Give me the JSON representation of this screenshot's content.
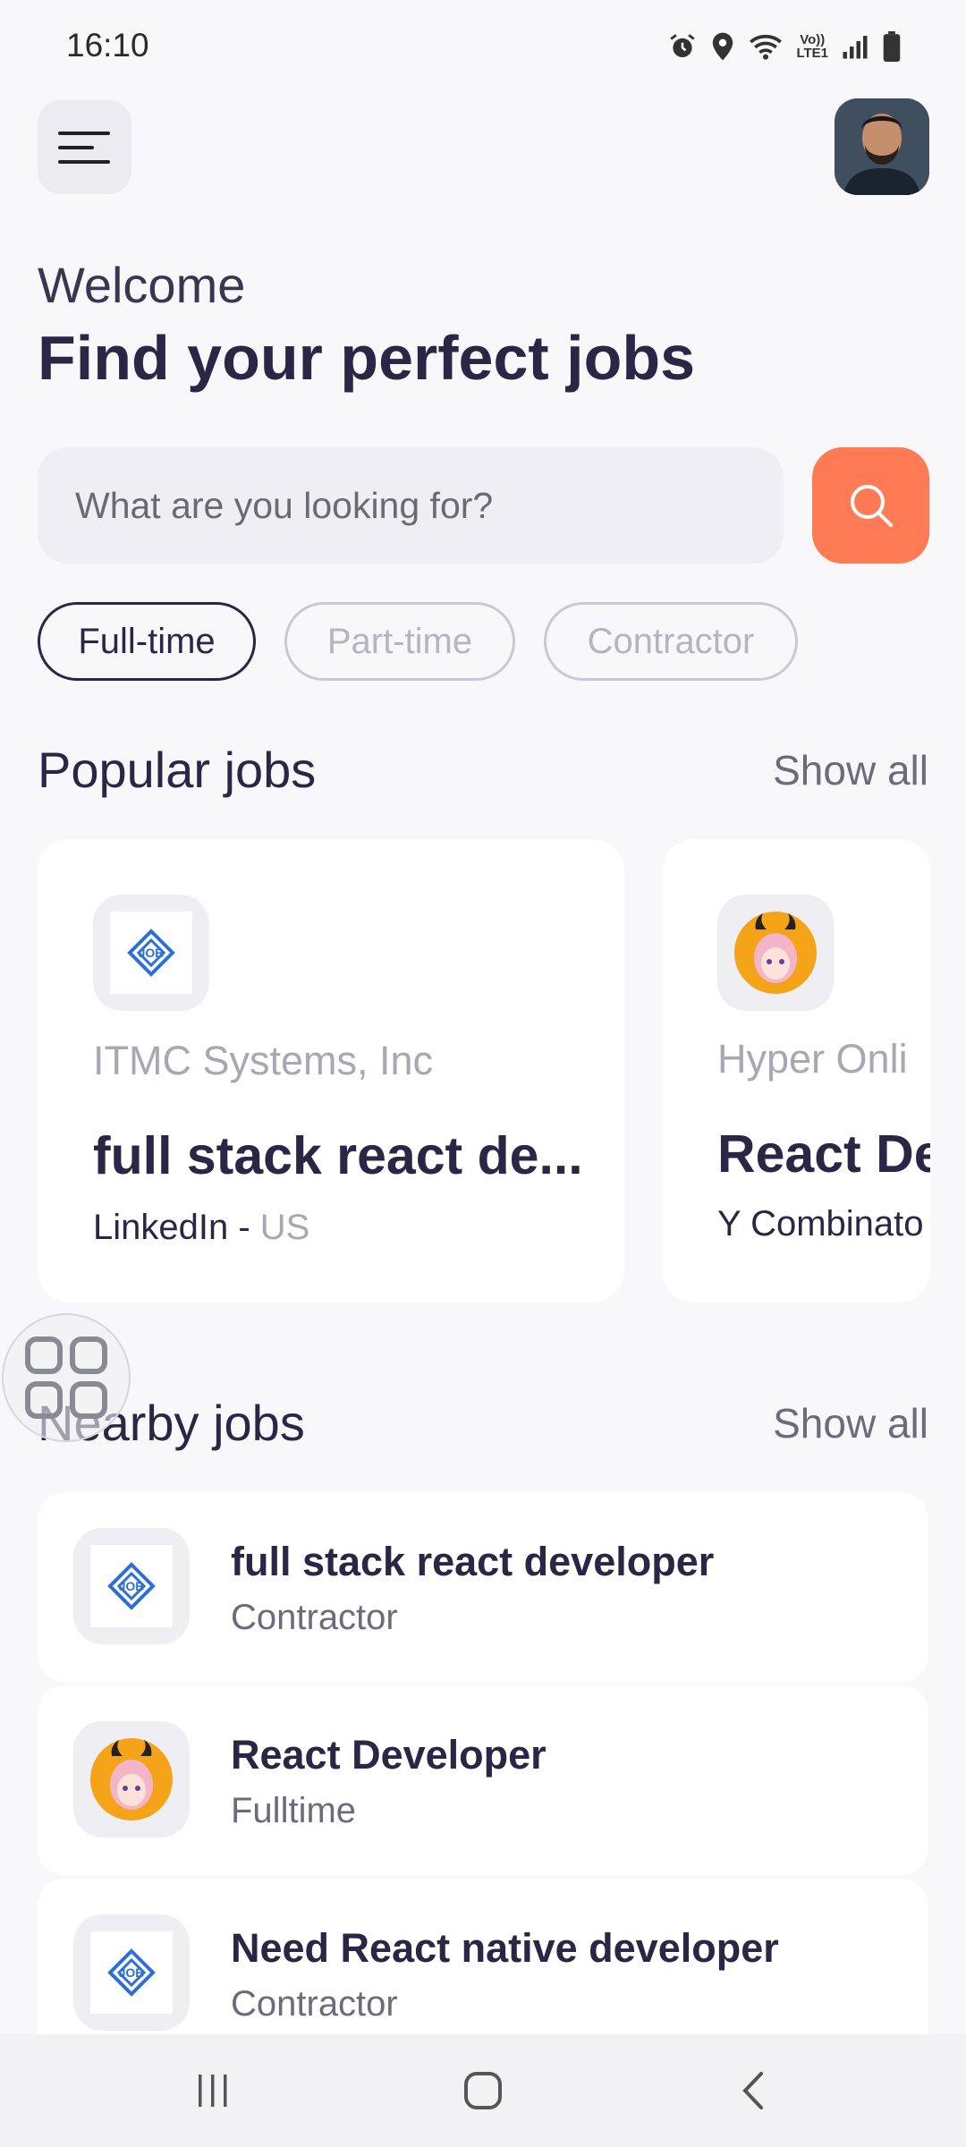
{
  "status_bar": {
    "time": "16:10",
    "network_label": "VoLTE1"
  },
  "header": {
    "menu_icon": "hamburger-menu-icon",
    "avatar_icon": "user-avatar"
  },
  "welcome": "Welcome",
  "headline": "Find your perfect jobs",
  "search": {
    "placeholder": "What are you looking for?",
    "button_icon": "search-icon"
  },
  "filters": [
    {
      "label": "Full-time",
      "active": true
    },
    {
      "label": "Part-time",
      "active": false
    },
    {
      "label": "Contractor",
      "active": false
    }
  ],
  "popular": {
    "title": "Popular jobs",
    "show_all": "Show all",
    "cards": [
      {
        "company": "ITMC Systems, Inc",
        "title": "full stack react de...",
        "source": "LinkedIn - ",
        "location": "US",
        "logo": "job-logo"
      },
      {
        "company": "Hyper Onli",
        "title": "React De",
        "source": "Y Combinato",
        "location": "",
        "logo": "anime-avatar-logo"
      }
    ]
  },
  "nearby": {
    "title": "Nearby jobs",
    "show_all": "Show all",
    "items": [
      {
        "title": "full stack react developer",
        "type": "Contractor",
        "logo": "job-logo"
      },
      {
        "title": "React Developer",
        "type": "Fulltime",
        "logo": "anime-avatar-logo"
      },
      {
        "title": "Need React native developer",
        "type": "Contractor",
        "logo": "job-logo"
      }
    ]
  },
  "colors": {
    "accent": "#fe7b56",
    "primary_text": "#2b2645",
    "muted_text": "#a8a7b3",
    "background": "#f8f8fb"
  }
}
